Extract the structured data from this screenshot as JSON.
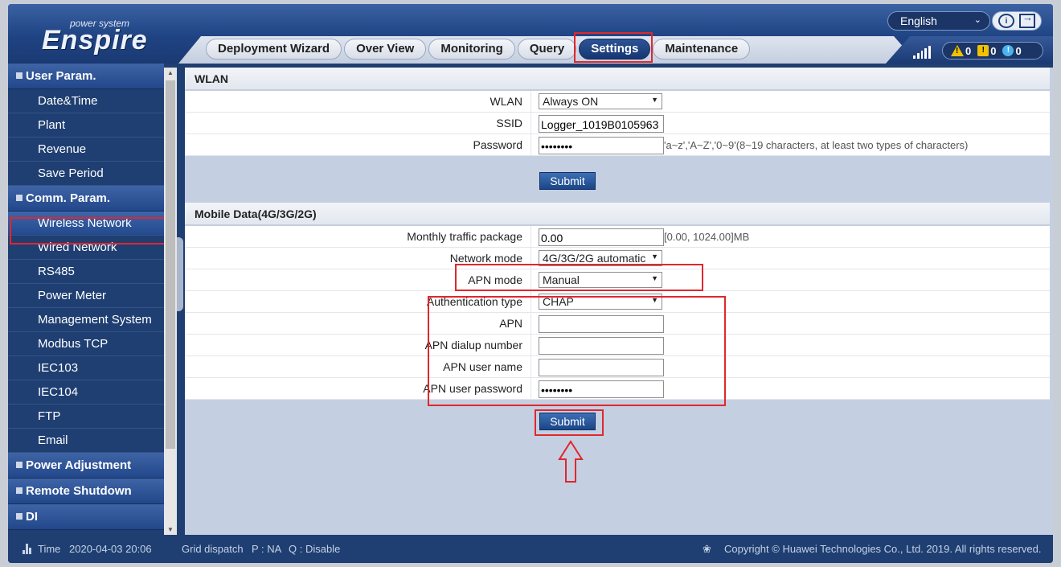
{
  "brand": {
    "tagline": "power system",
    "name": "Enspire"
  },
  "header": {
    "language": "English",
    "tabs": [
      {
        "label": "Deployment Wizard"
      },
      {
        "label": "Over View"
      },
      {
        "label": "Monitoring"
      },
      {
        "label": "Query"
      },
      {
        "label": "Settings",
        "active": true
      },
      {
        "label": "Maintenance"
      }
    ],
    "alarms": {
      "major": "0",
      "minor": "0",
      "warning": "0"
    },
    "colors": {
      "alarm_major": "#f2c200",
      "alarm_minor": "#f2c200",
      "alarm_warning": "#4cb2ef",
      "highlight": "#e0272c"
    }
  },
  "sidebar": {
    "groups": [
      {
        "label": "User Param.",
        "items": [
          "Date&Time",
          "Plant",
          "Revenue",
          "Save Period"
        ]
      },
      {
        "label": "Comm. Param.",
        "items": [
          "Wireless Network",
          "Wired Network",
          "RS485",
          "Power Meter",
          "Management System",
          "Modbus TCP",
          "IEC103",
          "IEC104",
          "FTP",
          "Email"
        ]
      },
      {
        "label": "Power Adjustment",
        "items": []
      },
      {
        "label": "Remote Shutdown",
        "items": []
      },
      {
        "label": "DI",
        "items": []
      }
    ],
    "active_item": "Wireless Network"
  },
  "wlan": {
    "title": "WLAN",
    "fields": {
      "wlan_label": "WLAN",
      "wlan_value": "Always ON",
      "ssid_label": "SSID",
      "ssid_value": "Logger_1019B0105963",
      "password_label": "Password",
      "password_value": "••••••••",
      "password_hint": "'a~z','A~Z','0~9'(8~19 characters, at least two types of characters)"
    },
    "submit": "Submit"
  },
  "mobile": {
    "title": "Mobile Data(4G/3G/2G)",
    "fields": {
      "traffic_label": "Monthly traffic package",
      "traffic_value": "0.00",
      "traffic_hint": "[0.00, 1024.00]MB",
      "network_label": "Network mode",
      "network_value": "4G/3G/2G automatic",
      "apn_mode_label": "APN mode",
      "apn_mode_value": "Manual",
      "auth_label": "Authentication type",
      "auth_value": "CHAP",
      "apn_label": "APN",
      "apn_value": "",
      "dialup_label": "APN dialup number",
      "dialup_value": "",
      "user_label": "APN user name",
      "user_value": "",
      "userpass_label": "APN user password",
      "userpass_value": "••••••••"
    },
    "submit": "Submit"
  },
  "footer": {
    "time_label": "Time",
    "time_value": "2020-04-03 20:06",
    "dispatch": "Grid dispatch",
    "p": "P : NA",
    "q": "Q : Disable",
    "copyright": "Copyright © Huawei Technologies Co., Ltd. 2019. All rights reserved."
  }
}
